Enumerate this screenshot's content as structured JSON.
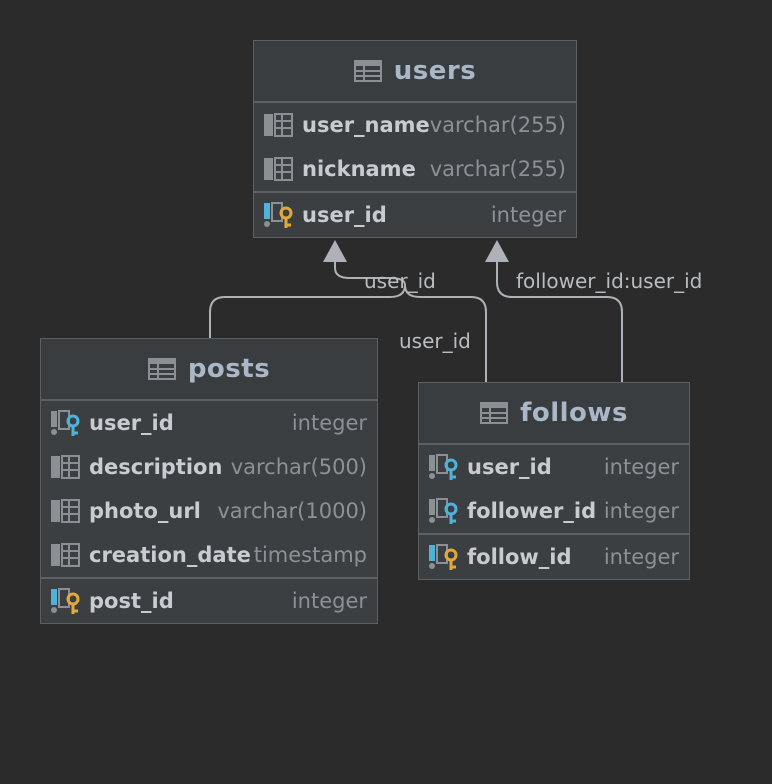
{
  "colors": {
    "background": "#2b2b2b",
    "table_bg": "#3c3f41",
    "border": "#5d6063",
    "title": "#a9b7c6",
    "column_name": "#c8ccd0",
    "column_type": "#8c9196",
    "edge": "#aeb1b5",
    "key_fk": "#4fb2d8",
    "key_pk": "#e2a83a",
    "grid_icon": "#8b9095"
  },
  "tables": {
    "users": {
      "name": "users",
      "columns": [
        {
          "name": "user_name",
          "type": "varchar(255)",
          "icon": "column-icon"
        },
        {
          "name": "nickname",
          "type": "varchar(255)",
          "icon": "column-icon"
        }
      ],
      "keys": [
        {
          "name": "user_id",
          "type": "integer",
          "icon": "primary-key-icon"
        }
      ]
    },
    "posts": {
      "name": "posts",
      "columns": [
        {
          "name": "user_id",
          "type": "integer",
          "icon": "foreign-key-icon"
        },
        {
          "name": "description",
          "type": "varchar(500)",
          "icon": "column-icon"
        },
        {
          "name": "photo_url",
          "type": "varchar(1000)",
          "icon": "column-icon"
        },
        {
          "name": "creation_date",
          "type": "timestamp",
          "icon": "column-icon"
        }
      ],
      "keys": [
        {
          "name": "post_id",
          "type": "integer",
          "icon": "primary-key-icon"
        }
      ]
    },
    "follows": {
      "name": "follows",
      "columns": [
        {
          "name": "user_id",
          "type": "integer",
          "icon": "foreign-key-icon"
        },
        {
          "name": "follower_id",
          "type": "integer",
          "icon": "foreign-key-icon"
        }
      ],
      "keys": [
        {
          "name": "follow_id",
          "type": "integer",
          "icon": "primary-key-icon"
        }
      ]
    }
  },
  "relations": {
    "posts_users": "user_id",
    "follows_user": "user_id",
    "follows_follower": "follower_id:user_id"
  }
}
